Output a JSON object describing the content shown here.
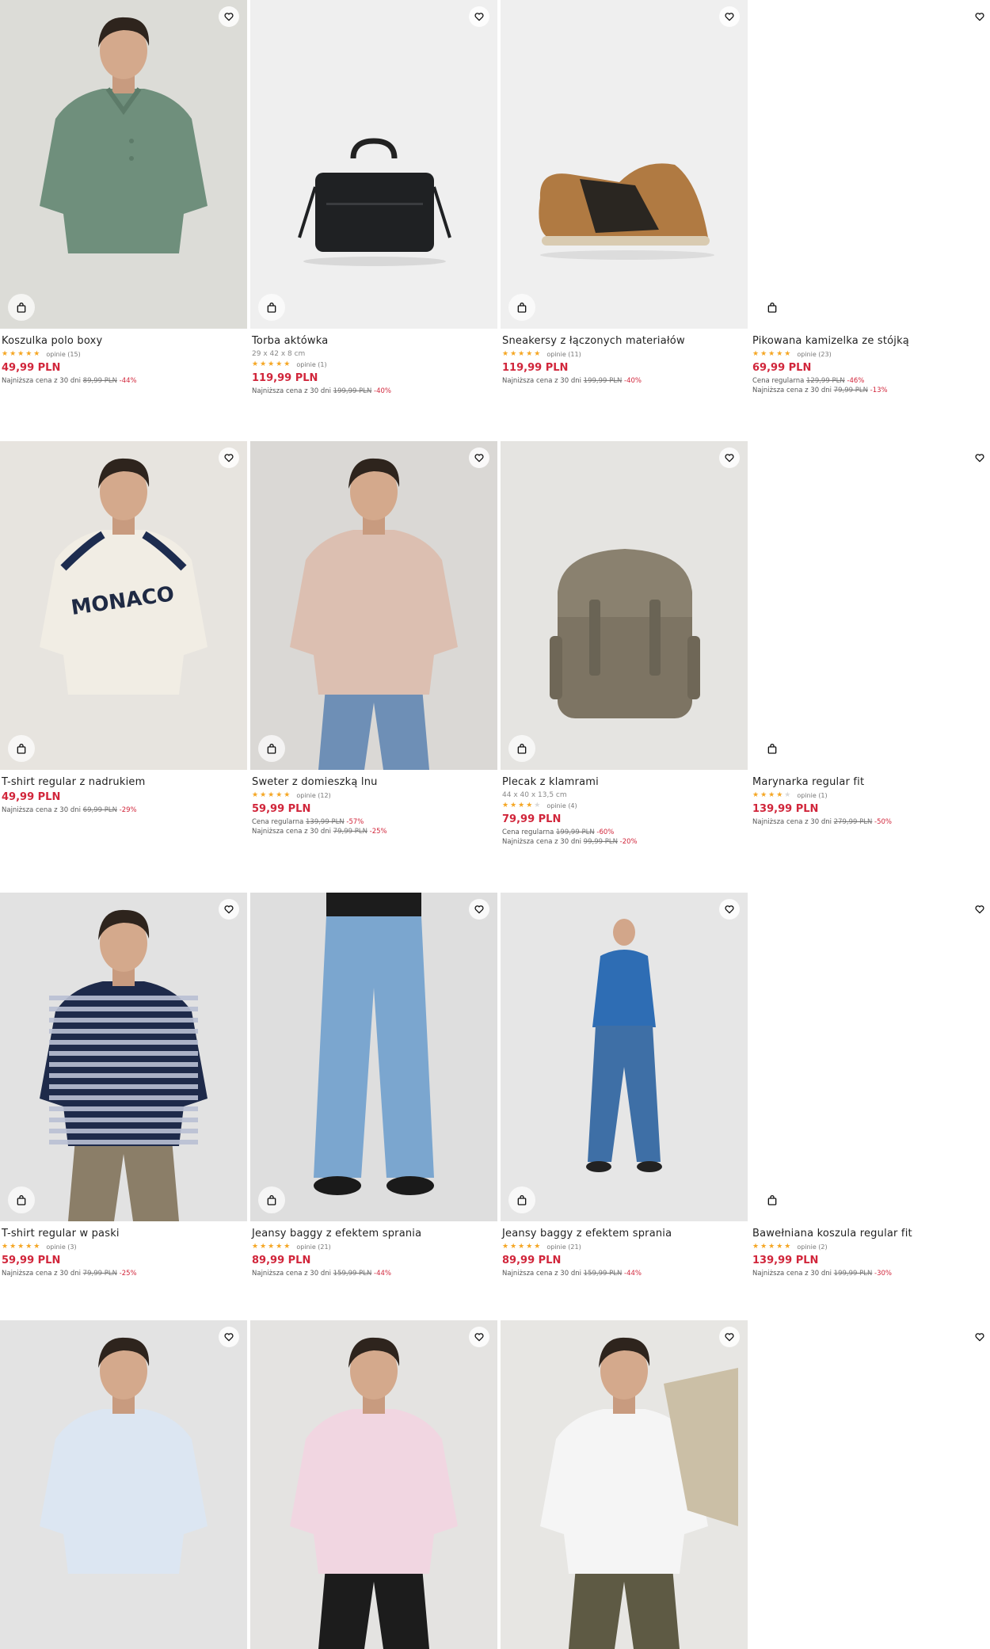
{
  "colors": {
    "price": "#d1263b",
    "star": "#f5a623",
    "background": "#ffffff"
  },
  "icons": {
    "wishlist": "heart-icon",
    "cart": "shopping-bag-icon"
  },
  "products": [
    {
      "name": "Koszulka polo boxy",
      "rating": 5,
      "reviews": "opinie (15)",
      "price": "49,99 PLN",
      "lines": [
        {
          "label": "Najniższa cena z 30 dni",
          "old": "89,99 PLN",
          "pct": "-44%"
        }
      ]
    },
    {
      "name": "Torba aktówka",
      "dims": "29 x 42 x 8 cm",
      "rating": 5,
      "reviews": "opinie (1)",
      "price": "119,99 PLN",
      "lines": [
        {
          "label": "Najniższa cena z 30 dni",
          "old": "199,99 PLN",
          "pct": "-40%"
        }
      ]
    },
    {
      "name": "Sneakersy z łączonych materiałów",
      "rating": 5,
      "reviews": "opinie (11)",
      "price": "119,99 PLN",
      "lines": [
        {
          "label": "Najniższa cena z 30 dni",
          "old": "199,99 PLN",
          "pct": "-40%"
        }
      ]
    },
    {
      "name": "Pikowana kamizelka ze stójką",
      "rating": 5,
      "reviews": "opinie (23)",
      "price": "69,99 PLN",
      "lines": [
        {
          "label": "Cena regularna",
          "old": "129,99 PLN",
          "pct": "-46%"
        },
        {
          "label": "Najniższa cena z 30 dni",
          "old": "79,99 PLN",
          "pct": "-13%"
        }
      ]
    },
    {
      "name": "T-shirt regular z nadrukiem",
      "price": "49,99 PLN",
      "lines": [
        {
          "label": "Najniższa cena z 30 dni",
          "old": "69,99 PLN",
          "pct": "-29%"
        }
      ]
    },
    {
      "name": "Sweter z domieszką lnu",
      "rating": 5,
      "reviews": "opinie (12)",
      "price": "59,99 PLN",
      "lines": [
        {
          "label": "Cena regularna",
          "old": "139,99 PLN",
          "pct": "-57%"
        },
        {
          "label": "Najniższa cena z 30 dni",
          "old": "79,99 PLN",
          "pct": "-25%"
        }
      ]
    },
    {
      "name": "Plecak z klamrami",
      "dims": "44 x 40 x 13,5 cm",
      "rating": 4.5,
      "reviews": "opinie (4)",
      "price": "79,99 PLN",
      "lines": [
        {
          "label": "Cena regularna",
          "old": "199,99 PLN",
          "pct": "-60%"
        },
        {
          "label": "Najniższa cena z 30 dni",
          "old": "99,99 PLN",
          "pct": "-20%"
        }
      ]
    },
    {
      "name": "Marynarka regular fit",
      "rating": 4,
      "reviews": "opinie (1)",
      "price": "139,99 PLN",
      "lines": [
        {
          "label": "Najniższa cena z 30 dni",
          "old": "279,99 PLN",
          "pct": "-50%"
        }
      ]
    },
    {
      "name": "T-shirt regular w paski",
      "rating": 5,
      "reviews": "opinie (3)",
      "price": "59,99 PLN",
      "lines": [
        {
          "label": "Najniższa cena z 30 dni",
          "old": "79,99 PLN",
          "pct": "-25%"
        }
      ]
    },
    {
      "name": "Jeansy baggy z efektem sprania",
      "rating": 5,
      "reviews": "opinie (21)",
      "price": "89,99 PLN",
      "lines": [
        {
          "label": "Najniższa cena z 30 dni",
          "old": "159,99 PLN",
          "pct": "-44%"
        }
      ]
    },
    {
      "name": "Jeansy baggy z efektem sprania",
      "rating": 5,
      "reviews": "opinie (21)",
      "price": "89,99 PLN",
      "lines": [
        {
          "label": "Najniższa cena z 30 dni",
          "old": "159,99 PLN",
          "pct": "-44%"
        }
      ]
    },
    {
      "name": "Bawełniana koszula regular fit",
      "rating": 5,
      "reviews": "opinie (2)",
      "price": "139,99 PLN",
      "lines": [
        {
          "label": "Najniższa cena z 30 dni",
          "old": "199,99 PLN",
          "pct": "-30%"
        }
      ]
    },
    {
      "name": "",
      "price": "",
      "lines": []
    },
    {
      "name": "",
      "price": "",
      "lines": []
    },
    {
      "name": "",
      "price": "",
      "lines": []
    },
    {
      "name": "",
      "price": "",
      "lines": []
    }
  ]
}
